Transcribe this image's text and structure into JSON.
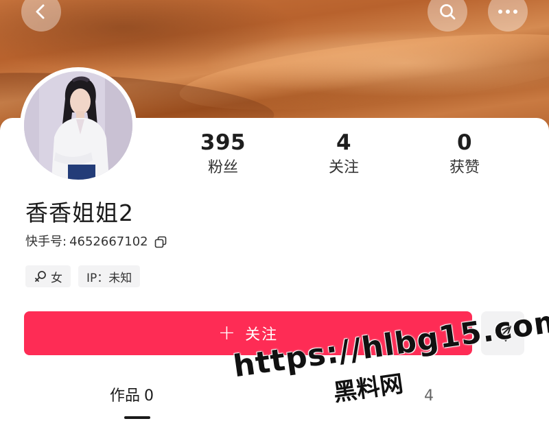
{
  "header": {
    "back_icon": "chevron-left-icon",
    "search_icon": "search-icon",
    "more_icon": "more-horizontal-icon"
  },
  "profile": {
    "name": "香香姐姐2",
    "kuaishou_id_label": "快手号:",
    "kuaishou_id": "4652667102",
    "tags": {
      "gender": "女",
      "ip": "IP：未知"
    }
  },
  "stats": [
    {
      "value": "395",
      "label": "粉丝"
    },
    {
      "value": "4",
      "label": "关注"
    },
    {
      "value": "0",
      "label": "获赞"
    }
  ],
  "actions": {
    "follow_plus": "+",
    "follow_label": "关注",
    "share_icon": "send-icon"
  },
  "tabs": [
    {
      "label": "作品",
      "count": "0"
    },
    {
      "label": "",
      "count": "4"
    }
  ],
  "watermark": {
    "url": "https://hlbg15.com",
    "site": "黑料网"
  },
  "colors": {
    "accent": "#fe2c55",
    "tag_bg": "#f3f3f4",
    "banner": "#c7733c"
  }
}
